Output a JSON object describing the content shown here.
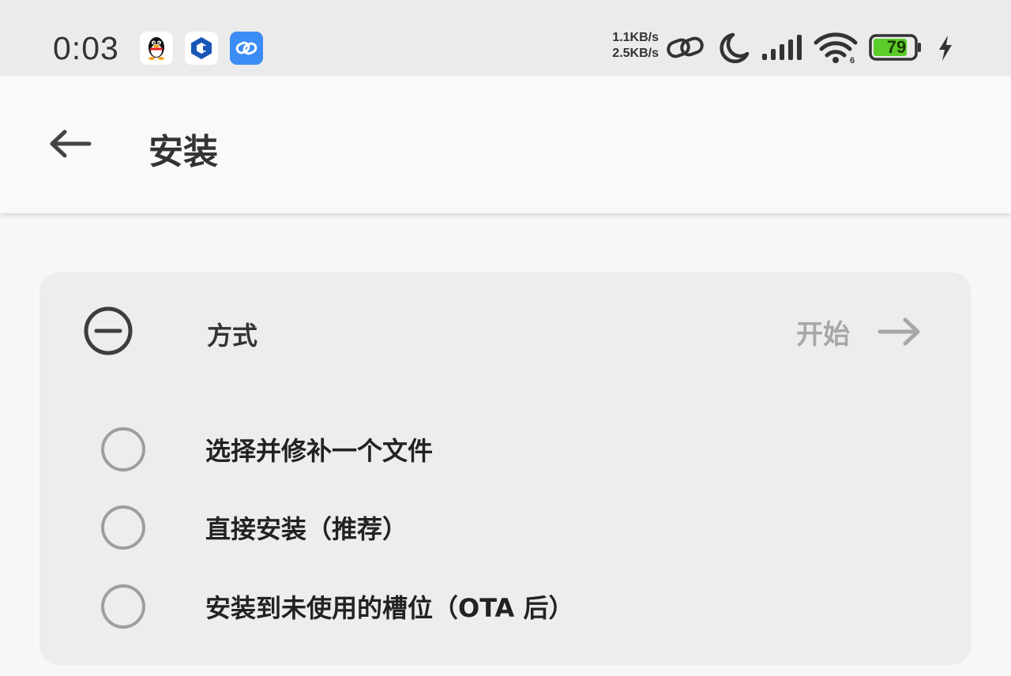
{
  "status_bar": {
    "time": "0:03",
    "upload_speed": "1.1KB/s",
    "download_speed": "2.5KB/s",
    "battery_level": "79",
    "battery_color": "#5ccc2a",
    "icons": [
      "qq-app-icon",
      "bank-app-icon",
      "link-app-icon",
      "hotspot-link-icon",
      "do-not-disturb-moon-icon",
      "cellular-signal-icon",
      "wifi-icon",
      "battery-icon",
      "charging-bolt-icon"
    ]
  },
  "app_bar": {
    "title": "安装",
    "back_icon": "back-arrow-icon"
  },
  "method_card": {
    "label": "方式",
    "header_icon": "minus-circle-icon",
    "start_label": "开始",
    "start_icon": "arrow-right-icon",
    "options": [
      {
        "label": "选择并修补一个文件",
        "selected": false
      },
      {
        "label": "直接安装（推荐）",
        "selected": false
      },
      {
        "label": "安装到未使用的槽位（OTA 后）",
        "selected": false
      }
    ]
  }
}
